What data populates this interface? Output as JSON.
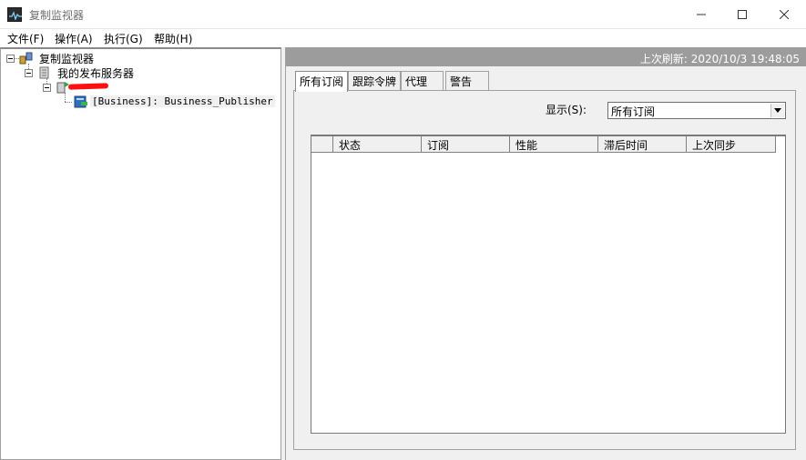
{
  "window": {
    "title": "复制监视器",
    "icon": "activity-monitor-icon"
  },
  "menu": [
    {
      "label": "文件(F)"
    },
    {
      "label": "操作(A)"
    },
    {
      "label": "执行(G)"
    },
    {
      "label": "帮助(H)"
    }
  ],
  "tree": {
    "root": "复制监视器",
    "publishers_group": "我的发布服务器",
    "server_name": "",
    "publication": "[Business]: Business_Publisher"
  },
  "right": {
    "last_refresh": "上次刷新: 2020/10/3 19:48:05",
    "tabs": [
      {
        "label": "所有订阅",
        "active": true
      },
      {
        "label": "跟踪令牌",
        "active": false
      },
      {
        "label": "代理",
        "active": false
      },
      {
        "label": "警告",
        "active": false
      }
    ],
    "show_label": "显示(S):",
    "show_value": "所有订阅",
    "columns": [
      "",
      "状态",
      "订阅",
      "性能",
      "滞后时间",
      "上次同步"
    ]
  },
  "colors": {
    "status_strip": "#9c9c9c",
    "redaction": "#ff1010"
  }
}
